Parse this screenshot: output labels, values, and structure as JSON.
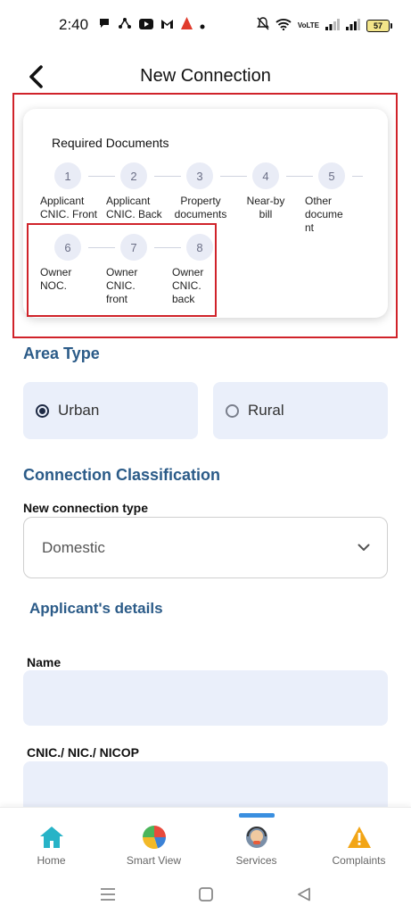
{
  "status_bar": {
    "time": "2:40",
    "network_label": "VoLTE",
    "battery_level": "57"
  },
  "header": {
    "back_icon": "back-arrow-icon",
    "title": "New Connection"
  },
  "required_documents": {
    "title": "Required Documents",
    "steps": [
      {
        "number": "1",
        "label": "Applicant CNIC. Front"
      },
      {
        "number": "2",
        "label": "Applicant CNIC. Back"
      },
      {
        "number": "3",
        "label": "Property documents"
      },
      {
        "number": "4",
        "label": "Near-by bill"
      },
      {
        "number": "5",
        "label": "Other docume nt"
      },
      {
        "number": "6",
        "label": "Owner NOC."
      },
      {
        "number": "7",
        "label": "Owner CNIC. front"
      },
      {
        "number": "8",
        "label": "Owner CNIC. back"
      }
    ]
  },
  "area_type": {
    "title": "Area Type",
    "options": [
      {
        "label": "Urban",
        "selected": true
      },
      {
        "label": "Rural",
        "selected": false
      }
    ]
  },
  "connection_classification": {
    "title": "Connection Classification",
    "type_label": "New connection type",
    "type_value": "Domestic"
  },
  "applicant_details": {
    "title": "Applicant's details",
    "name_label": "Name",
    "name_value": "",
    "cnic_label": "CNIC./ NIC./ NICOP",
    "cnic_value": ""
  },
  "bottom_nav": {
    "items": [
      {
        "label": "Home",
        "icon": "home-icon"
      },
      {
        "label": "Smart View",
        "icon": "pie-chart-icon"
      },
      {
        "label": "Services",
        "icon": "support-agent-icon",
        "active": true
      },
      {
        "label": "Complaints",
        "icon": "warning-icon"
      }
    ]
  },
  "colors": {
    "section_title": "#2b5b88",
    "tile_background": "#eaeffa",
    "highlight": "#d0232a",
    "active_indicator": "#3a8fe0"
  }
}
